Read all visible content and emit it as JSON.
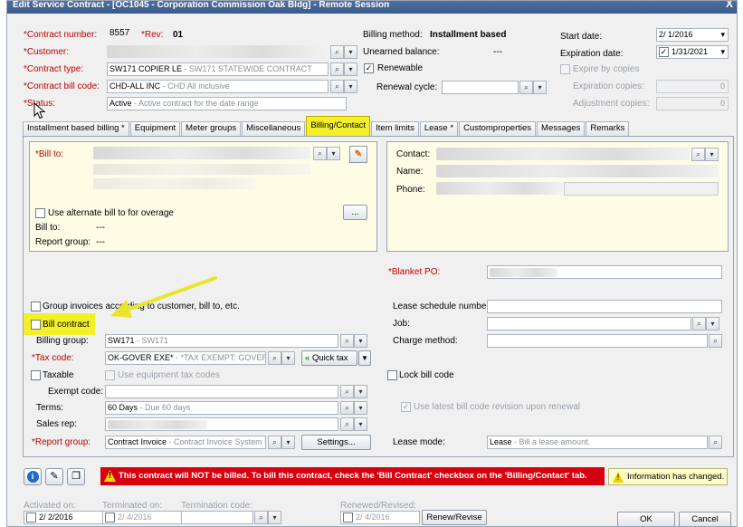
{
  "window": {
    "title": "Edit Service Contract - [OC1045 - Corporation Commission Oak Bldg] - Remote Session",
    "close_label": "X"
  },
  "header": {
    "contract_number_label": "*Contract number:",
    "contract_number": "8557",
    "rev_label": "*Rev:",
    "rev": "01",
    "customer_label": "*Customer:",
    "contract_type_label": "*Contract type:",
    "contract_type_code": "SW171 COPIER LE",
    "contract_type_desc": " - SW171 STATEWIDE CONTRACT",
    "contract_bill_code_label": "*Contract bill code:",
    "bill_code": "CHD-ALL INC",
    "bill_code_desc": " - CHD All inclusive",
    "status_label": "*Status:",
    "status": "Active",
    "status_desc": " - Active contract for the date range",
    "billing_method_label": "Billing method:",
    "billing_method": "Installment based",
    "unearned_balance_label": "Unearned balance:",
    "unearned_balance": "---",
    "renewable_label": "Renewable",
    "renewable_check": "✓",
    "renewal_cycle_label": "Renewal cycle:",
    "start_date_label": "Start date:",
    "start_date": "2/  1/2016",
    "expiration_date_label": "Expiration date:",
    "expiration_date": "1/31/2021",
    "expiration_check": "✓",
    "expire_by_copies_label": "Expire by copies",
    "expiration_copies_label": "Expiration copies:",
    "expiration_copies": "0",
    "adjustment_copies_label": "Adjustment copies:",
    "adjustment_copies": "0"
  },
  "tabs": [
    "Installment based billing *",
    "Equipment",
    "Meter groups",
    "Miscellaneous",
    "Billing/Contact",
    "Item limits",
    "Lease *",
    "Customproperties",
    "Messages",
    "Remarks"
  ],
  "billing": {
    "bill_to_label": "*Bill to:",
    "use_alternate_label": "Use alternate bill to for overage",
    "ellipsis": "...",
    "bill_to2_label": "Bill to:",
    "bill_to2_value": "---",
    "report_group_label": "Report group:",
    "report_group_value": "---",
    "contact_label": "Contact:",
    "name_label": "Name:",
    "phone_label": "Phone:",
    "blanket_po_label": "*Blanket PO:",
    "group_invoices_label": "Group invoices according to customer, bill to, etc.",
    "lease_schedule_label": "Lease schedule number:",
    "bill_contract_label": "Bill contract",
    "job_label": "Job:",
    "billing_group_label": "Billing group:",
    "billing_group": "SW171",
    "billing_group_desc": " - SW171",
    "charge_method_label": "Charge method:",
    "tax_code_label": "*Tax code:",
    "tax_code": "OK-GOVER EXE*",
    "tax_code_desc": " - *TAX EXEMPT: GOVERNME",
    "quick_tax_label": "Quick tax",
    "taxable_label": "Taxable",
    "use_equipment_tax_label": "Use equipment tax codes",
    "lock_bill_code_label": "Lock bill code",
    "exempt_code_label": "Exempt code:",
    "terms_label": "Terms:",
    "terms": "60 Days",
    "terms_desc": " - Due 60 days",
    "use_latest_label": "Use latest bill code revision upon renewal",
    "use_latest_check": "✓",
    "sales_rep_label": "Sales rep:",
    "report_group2_label": "*Report group:",
    "report_group2": "Contract Invoice",
    "report_group2_desc": " - Contract Invoice System D",
    "settings_label": "Settings...",
    "lease_mode_label": "Lease mode:",
    "lease_mode": "Lease",
    "lease_mode_desc": " - Bill a lease amount."
  },
  "footer": {
    "warning": "This contract will NOT be billed.  To bill this contract, check the 'Bill Contract' checkbox on the 'Billing/Contact' tab.",
    "info": "Information has changed.",
    "activated_on_label": "Activated on:",
    "activated_on": "2/  2/2016",
    "terminated_on_label": "Terminated on:",
    "terminated_on": "2/  4/2016",
    "termination_code_label": "Termination code:",
    "renewed_label": "Renewed/Revised:",
    "renewed_on": "2/  4/2016",
    "renew_button": "Renew/Revise",
    "ok_button": "OK",
    "cancel_button": "Cancel"
  },
  "colors": {
    "highlight": "#f3ef29",
    "warning_red": "#d7000f",
    "panel_yellow": "#fdfde6",
    "arrow": "#e9e62a"
  }
}
